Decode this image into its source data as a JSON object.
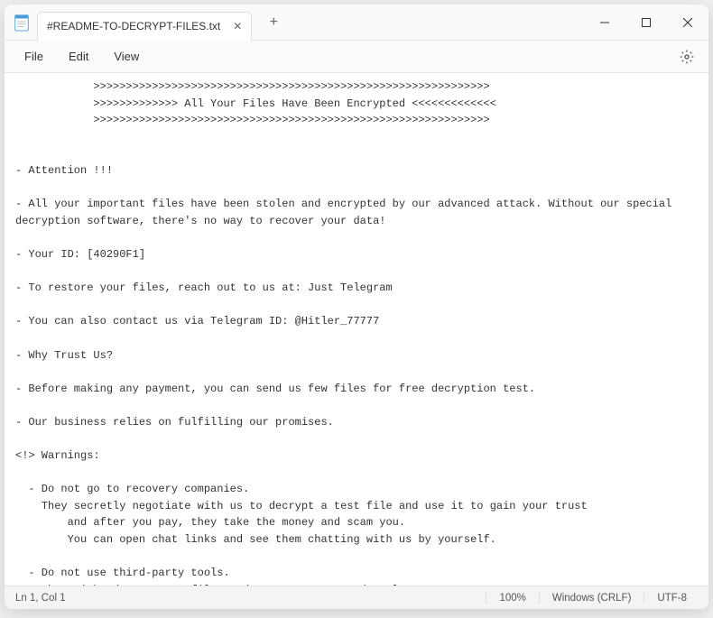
{
  "titlebar": {
    "tab_title": "#README-TO-DECRYPT-FILES.txt",
    "tab_close": "✕",
    "new_tab": "+"
  },
  "menubar": {
    "file": "File",
    "edit": "Edit",
    "view": "View"
  },
  "content": {
    "text": "            >>>>>>>>>>>>>>>>>>>>>>>>>>>>>>>>>>>>>>>>>>>>>>>>>>>>>>>>>>>>>\n            >>>>>>>>>>>>> All Your Files Have Been Encrypted <<<<<<<<<<<<<\n            >>>>>>>>>>>>>>>>>>>>>>>>>>>>>>>>>>>>>>>>>>>>>>>>>>>>>>>>>>>>>\n\n\n- Attention !!!\n\n- All your important files have been stolen and encrypted by our advanced attack. Without our special decryption software, there's no way to recover your data!\n\n- Your ID: [40290F1]\n\n- To restore your files, reach out to us at: Just Telegram\n\n- You can also contact us via Telegram ID: @Hitler_77777\n\n- Why Trust Us?\n\n- Before making any payment, you can send us few files for free decryption test.\n\n- Our business relies on fulfilling our promises.\n\n<!> Warnings:\n\n  - Do not go to recovery companies.\n    They secretly negotiate with us to decrypt a test file and use it to gain your trust\n        and after you pay, they take the money and scam you.\n        You can open chat links and see them chatting with us by yourself.\n\n  - Do not use third-party tools.\n    They might damage your files and cause permanent data loss.\n\n- How to Buy Bitcoin?\n\n- You can purchase Bitcoin to pay the ransom using these trusted platforms:\n\n- https://www.kraken.com/learn/buy-bitcoin-btc\n- https://www.coinbase.com/en-gb/how-to-buy/bitcoin\n- https://paxful.com"
  },
  "statusbar": {
    "position": "Ln 1, Col 1",
    "zoom": "100%",
    "line_ending": "Windows (CRLF)",
    "encoding": "UTF-8"
  }
}
